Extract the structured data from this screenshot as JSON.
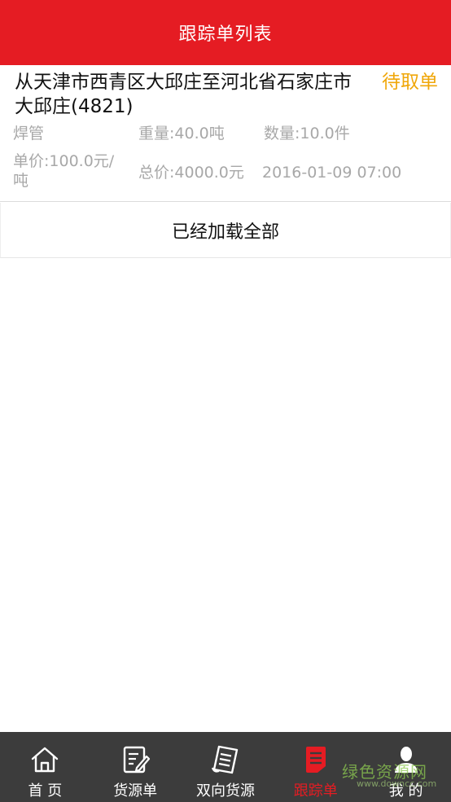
{
  "header": {
    "title": "跟踪单列表"
  },
  "order": {
    "route": "从天津市西青区大邱庄至河北省石家庄市大邱庄(4821)",
    "status": "待取单",
    "status_color": "#f0a70a",
    "goods": "焊管",
    "weight": "重量:40.0吨",
    "count": "数量:10.0件",
    "unit_price": "单价:100.0元/吨",
    "total_price": "总价:4000.0元",
    "datetime": "2016-01-09 07:00"
  },
  "list_footer": {
    "text": "已经加载全部"
  },
  "tabbar": {
    "items": [
      {
        "label": "首  页",
        "icon": "home-icon",
        "active": false
      },
      {
        "label": "货源单",
        "icon": "edit-document-icon",
        "active": false
      },
      {
        "label": "双向货源",
        "icon": "list-document-icon",
        "active": false
      },
      {
        "label": "跟踪单",
        "icon": "tracking-document-icon",
        "active": true
      },
      {
        "label": "我  的",
        "icon": "user-icon",
        "active": false
      }
    ],
    "active_color": "#e51c23"
  },
  "watermark": {
    "text": "绿色资源网",
    "sub": "www.downcc.com"
  },
  "colors": {
    "header_bg": "#e51c23",
    "tabbar_bg": "#3c3c3c"
  }
}
